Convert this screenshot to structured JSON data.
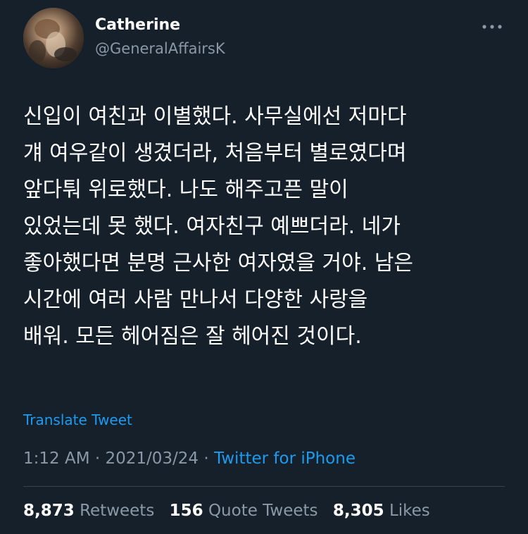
{
  "author": {
    "display_name": "Catherine",
    "handle": "@GeneralAffairsK"
  },
  "menu": {
    "icon": "more-horizontal-icon"
  },
  "tweet": {
    "lines": [
      "신입이 여친과 이별했다. 사무실에선 저마다",
      "걔 여우같이 생겼더라, 처음부터 별로였다며",
      "앞다퉈 위로했다. 나도 해주고픈 말이",
      "있었는데 못 했다. 여자친구 예쁘더라. 네가",
      "좋아했다면 분명 근사한 여자였을 거야. 남은",
      "시간에 여러 사람 만나서 다양한 사랑을",
      "배워. 모든 헤어짐은 잘 헤어진 것이다."
    ],
    "translate_label": "Translate Tweet"
  },
  "meta": {
    "time": "1:12 AM",
    "separator": "·",
    "date": "2021/03/24",
    "source": "Twitter for iPhone"
  },
  "stats": {
    "retweets_count": "8,873",
    "retweets_label": "Retweets",
    "quotes_count": "156",
    "quotes_label": "Quote Tweets",
    "likes_count": "8,305",
    "likes_label": "Likes"
  },
  "colors": {
    "background": "#15202b",
    "text_primary": "#ffffff",
    "text_secondary": "#8b98a5",
    "link": "#1d9bf0",
    "divider": "#38444d"
  }
}
